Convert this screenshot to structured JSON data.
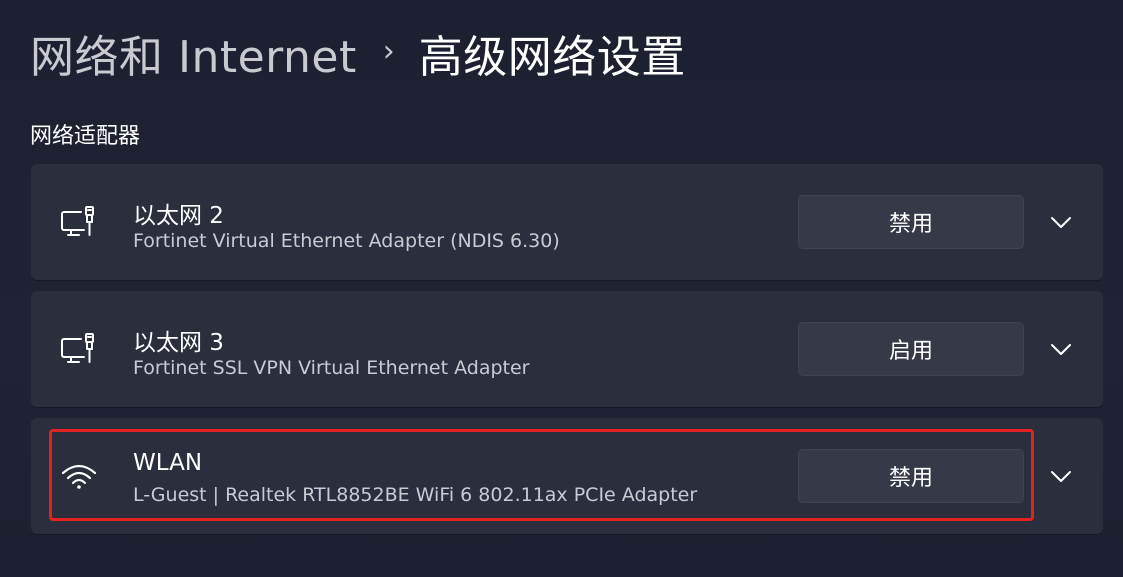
{
  "breadcrumb": {
    "parent": "网络和 Internet",
    "separator": "›",
    "current": "高级网络设置"
  },
  "section": {
    "title": "网络适配器"
  },
  "adapters": [
    {
      "name": "以太网 2",
      "description": "Fortinet Virtual Ethernet Adapter (NDIS 6.30)",
      "action_label": "禁用",
      "icon": "ethernet-icon"
    },
    {
      "name": "以太网 3",
      "description": "Fortinet SSL VPN Virtual Ethernet Adapter",
      "action_label": "启用",
      "icon": "ethernet-icon"
    },
    {
      "name": "WLAN",
      "description": "L-Guest | Realtek RTL8852BE WiFi 6 802.11ax PCIe Adapter",
      "action_label": "禁用",
      "icon": "wifi-icon"
    }
  ],
  "colors": {
    "background": "#1c2030",
    "card": "#2a2e3d",
    "button": "#363a48",
    "highlight": "#e32222"
  }
}
